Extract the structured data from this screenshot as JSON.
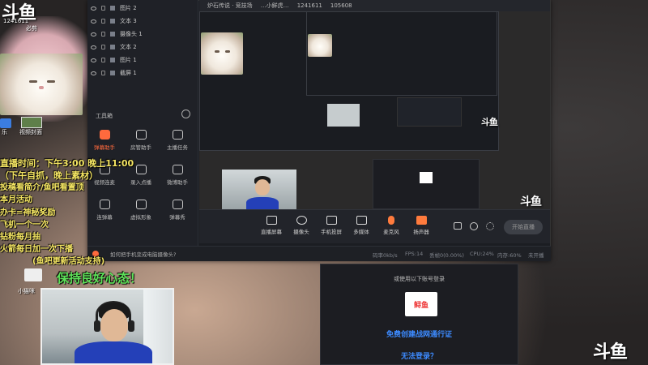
{
  "brand": {
    "logo_text": "斗鱼"
  },
  "room": {
    "id_number": "1241611",
    "nickname": "必剪"
  },
  "desktop_shortcuts": {
    "item1": "乐",
    "item2": "视频封面"
  },
  "layers": [
    {
      "name": "图片 2"
    },
    {
      "name": "文本 3"
    },
    {
      "name": "摄像头 1"
    },
    {
      "name": "文本 2"
    },
    {
      "name": "图片 1"
    },
    {
      "name": "截屏 1"
    }
  ],
  "toolbox": {
    "title": "工具箱",
    "tools": [
      {
        "label": "弹幕助手",
        "icon": "danmaku-icon"
      },
      {
        "label": "房管助手",
        "icon": "room-admin-icon"
      },
      {
        "label": "主播任务",
        "icon": "task-icon"
      },
      {
        "label": "视频连麦",
        "icon": "video-link-icon"
      },
      {
        "label": "录入点播",
        "icon": "record-icon"
      },
      {
        "label": "微博助手",
        "icon": "weibo-icon"
      },
      {
        "label": "连弹幕",
        "icon": "chat-icon"
      },
      {
        "label": "虚拟形象",
        "icon": "avatar-icon"
      },
      {
        "label": "弹幕秀",
        "icon": "show-icon"
      }
    ]
  },
  "preview_header": {
    "tab1": "炉石传说 · 竞技场",
    "tab2": "…小鲜虎…",
    "room_id": "1241611",
    "hot": "105608"
  },
  "controls": [
    {
      "label": "直播屏幕",
      "icon": "screen-icon"
    },
    {
      "label": "摄像头",
      "icon": "camera-icon"
    },
    {
      "label": "手机投屏",
      "icon": "phone-icon"
    },
    {
      "label": "多媒体",
      "icon": "media-icon"
    },
    {
      "label": "麦克风",
      "icon": "mic-icon"
    },
    {
      "label": "扬声器",
      "icon": "speaker-icon"
    }
  ],
  "go_live": {
    "label": "开始直播"
  },
  "status": {
    "question": "如何把手机变成电脑摄像头?",
    "bitrate": "码率0kb/s",
    "fps": "FPS:14",
    "lost": "丢帧0(0.00%)",
    "cpu": "CPU:24%",
    "mem": "内存:60%",
    "recording": "未开播"
  },
  "login": {
    "prompt": "或使用以下账号登录",
    "app_name": "鲟鱼",
    "register": "免费创建战网通行证",
    "cant_login": "无法登录？"
  },
  "overlay": {
    "schedule_label": "直播时间：下午3:00 晚上11:00",
    "schedule_note": "（下午自抓，晚上素材）",
    "line3": "投稿看简介/鱼吧看置顶",
    "line4": "本月活动",
    "line5": "办卡=神秘奖励",
    "line6": "飞机一个一次",
    "line7": "钻粉每月抽",
    "line8": "火箭每日加一次下播",
    "line9": "(鱼吧更新活动支持)",
    "good_mood": "保持良好心态！",
    "small_nick": "小猫咪"
  },
  "colors": {
    "accent": "#ff6a3d",
    "link": "#3d8bff",
    "overlay_yellow": "#f5e663",
    "overlay_green": "#5ee35a"
  }
}
